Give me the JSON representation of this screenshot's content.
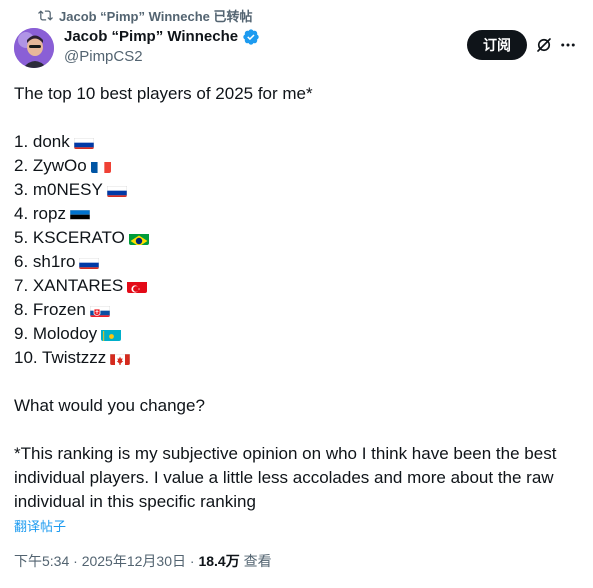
{
  "repost": {
    "label": "Jacob “Pimp” Winneche 已转帖"
  },
  "author": {
    "name": "Jacob “Pimp” Winneche",
    "handle": "@PimpCS2"
  },
  "actions": {
    "subscribe_label": "订阅"
  },
  "tweet": {
    "intro": "The top 10 best players of 2025 for me*",
    "players": [
      {
        "text": "1. donk",
        "flag": "russia-flag"
      },
      {
        "text": "2. ZywOo",
        "flag": "france-flag"
      },
      {
        "text": "3. m0NESY",
        "flag": "russia-flag"
      },
      {
        "text": "4. ropz",
        "flag": "estonia-flag"
      },
      {
        "text": "5. KSCERATO",
        "flag": "brazil-flag"
      },
      {
        "text": "6. sh1ro",
        "flag": "russia-flag"
      },
      {
        "text": "7. XANTARES",
        "flag": "turkey-flag"
      },
      {
        "text": "8. Frozen",
        "flag": "slovakia-flag"
      },
      {
        "text": "9. Molodoy",
        "flag": "kazakhstan-flag"
      },
      {
        "text": "10. Twistzzz",
        "flag": "canada-flag"
      }
    ],
    "question": "What would you change?",
    "note": "*This ranking is my subjective opinion on who I think have been the best individual players. I value a little less accolades and more about the raw individual in this specific ranking"
  },
  "translate_label": "翻译帖子",
  "meta": {
    "time": "下午5:34",
    "separator": "·",
    "date": "2025年12月30日",
    "views": "18.4万",
    "views_label": "查看"
  },
  "colors": {
    "accent": "#1d9bf0",
    "text": "#0f1419",
    "secondary": "#536471"
  }
}
